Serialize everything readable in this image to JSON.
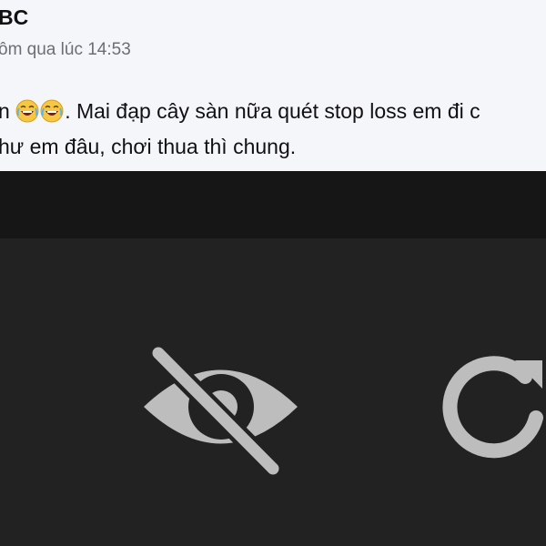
{
  "post": {
    "author": "BC",
    "timestamp": "ôm qua lúc 14:53",
    "message_line1_prefix": "n",
    "message_line1_text": ". Mai đạp cây sàn nữa quét stop loss em đi c",
    "message_line2": "hư em đâu, chơi thua thì chung."
  },
  "icons": {
    "emoji_1": "tears-of-joy-emoji",
    "emoji_2": "tears-of-joy-emoji",
    "hide": "eye-off-icon",
    "refresh": "refresh-icon"
  },
  "colors": {
    "post_background": "#f4f6f9",
    "viewer_background": "#222222",
    "toolbar_background": "#161616",
    "icon_color": "#bdbdbd"
  }
}
